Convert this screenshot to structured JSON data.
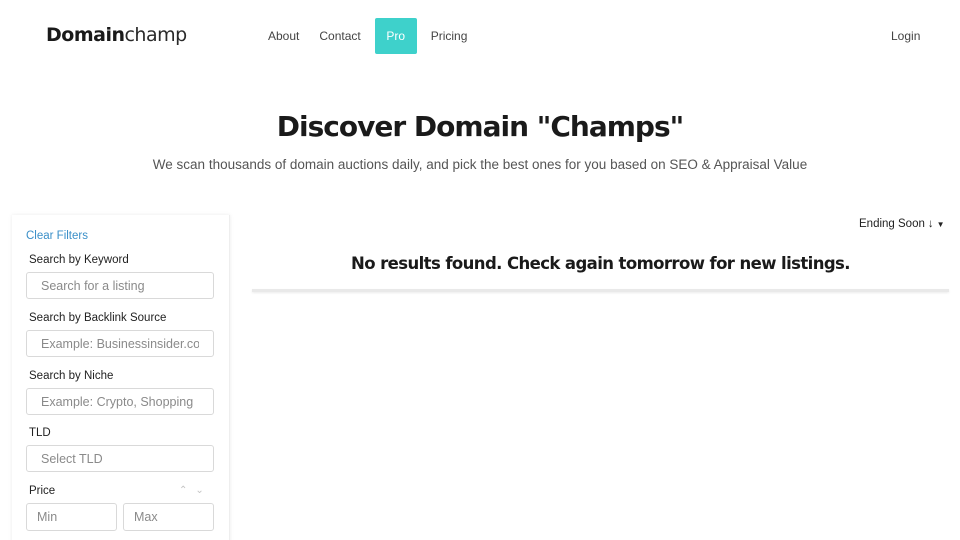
{
  "header": {
    "logo_bold": "Domain",
    "logo_light": "champ",
    "nav": [
      "About",
      "Contact",
      "Pro",
      "Pricing"
    ],
    "login": "Login",
    "accent_color": "#3ed1cb"
  },
  "hero": {
    "title": "Discover Domain \"Champs\"",
    "subtitle": "We scan thousands of domain auctions daily, and pick the best ones for you based on SEO & Appraisal Value"
  },
  "filters": {
    "clear": "Clear Filters",
    "keyword_label": "Search by Keyword",
    "keyword_placeholder": "Search for a listing",
    "backlink_label": "Search by Backlink Source",
    "backlink_placeholder": "Example: Businessinsider.com",
    "niche_label": "Search by Niche",
    "niche_placeholder": "Example: Crypto, Shopping",
    "tld_label": "TLD",
    "tld_placeholder": "Select TLD",
    "price_label": "Price",
    "price_min_placeholder": "Min",
    "price_max_placeholder": "Max"
  },
  "results": {
    "sort_label": "Ending Soon",
    "sort_icon": "arrow-down-icon",
    "empty_message": "No results found. Check again tomorrow for new listings."
  }
}
